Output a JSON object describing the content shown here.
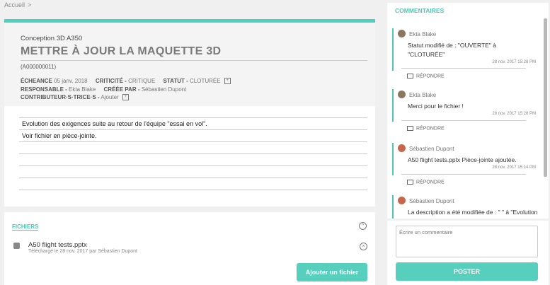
{
  "breadcrumb": {
    "home": "Accueil",
    "separator": ">"
  },
  "task": {
    "project": "Conception 3D A350",
    "title": "METTRE À JOUR LA MAQUETTE 3D",
    "id": "(A000000011)",
    "due_label": "ÉCHEANCE",
    "due_value": "05 janv. 2018",
    "criticality_label": "CRITICITÉ -",
    "criticality_value": "CRITIQUE",
    "status_label": "STATUT -",
    "status_value": "CLOTURÉE",
    "owner_label": "RESPONSABLE -",
    "owner_value": "Ekta Blake",
    "created_label": "CRÉÉE PAR -",
    "created_value": "Sébastien Dupont",
    "contrib_label": "CONTRIBUTEUR·S·TRICE·S -",
    "contrib_value": "Ajouter",
    "description": [
      "Evolution des exigences suite au retour de l'équipe \"essai en vol\".",
      "Voir fichier en pièce-jointe.",
      "",
      "",
      "",
      ""
    ]
  },
  "files": {
    "title": "FICHIERS",
    "items": [
      {
        "name": "A50 flight tests.pptx",
        "meta": "Téléchargé le 28 nov. 2017 par Sébastien Dupont"
      }
    ],
    "add_button": "Ajouter un fichier"
  },
  "comments": {
    "title": "COMMENTAIRES",
    "reply_label": "RÉPONDRE",
    "items": [
      {
        "author": "Ekta Blake",
        "text": "Statut modifié de : \"OUVERTE\" à \"CLOTURÉE\"",
        "date": "28 nov. 2017 15:28 PM"
      },
      {
        "author": "Ekta Blake",
        "text": "Merci pour le fichier !",
        "date": "28 nov. 2017 15:28 PM"
      },
      {
        "author": "Sébastien Dupont",
        "text": "A50 flight tests.pptx Pièce-jointe ajoutée.",
        "date": "28 nov. 2017 15:14 PM"
      },
      {
        "author": "Sébastien Dupont",
        "text": "La description a été modifiée de : \" \" à \"Evolution des exigences suite au retour",
        "date": ""
      }
    ]
  },
  "compose": {
    "placeholder": "Écrire un commentaire",
    "post_button": "POSTER"
  },
  "colors": {
    "accent": "#4fd1c0",
    "button": "#56cfbd"
  }
}
